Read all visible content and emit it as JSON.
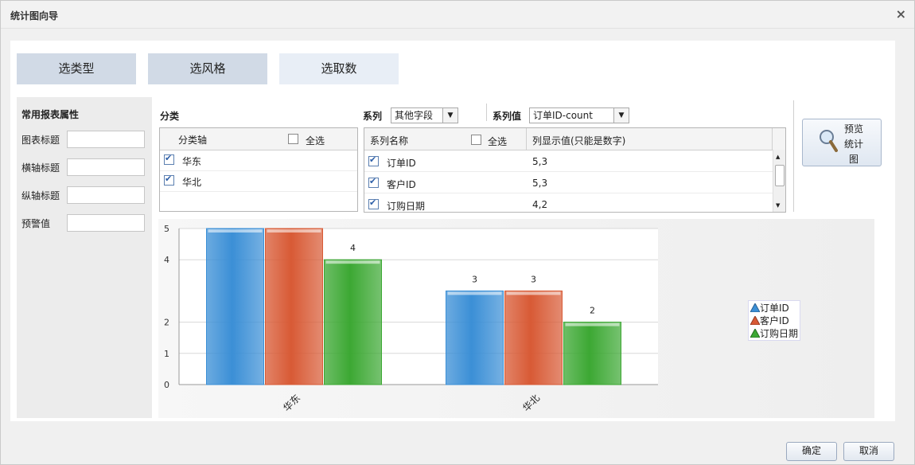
{
  "window": {
    "title": "统计图向导",
    "close_icon": "×"
  },
  "tabs": [
    {
      "label": "选类型",
      "active": false
    },
    {
      "label": "选风格",
      "active": false
    },
    {
      "label": "选取数",
      "active": true
    }
  ],
  "left_panel": {
    "title": "常用报表属性",
    "fields": [
      {
        "label": "图表标题",
        "value": ""
      },
      {
        "label": "横轴标题",
        "value": ""
      },
      {
        "label": "纵轴标题",
        "value": ""
      },
      {
        "label": "预警值",
        "value": ""
      }
    ]
  },
  "category": {
    "label": "分类",
    "header": "分类轴",
    "select_all": "全选",
    "items": [
      {
        "label": "华东",
        "checked": true
      },
      {
        "label": "华北",
        "checked": true
      }
    ]
  },
  "series": {
    "label": "系列",
    "select_value": "其他字段",
    "value_label": "系列值",
    "value_select": "订单ID-count",
    "col_name": "系列名称",
    "select_all": "全选",
    "col_display": "列显示值(只能是数字)",
    "rows": [
      {
        "name": "订单ID",
        "display": "5,3",
        "checked": true
      },
      {
        "name": "客户ID",
        "display": "5,3",
        "checked": true
      },
      {
        "name": "订购日期",
        "display": "4,2",
        "checked": true
      }
    ]
  },
  "preview_button": {
    "line1": "预览",
    "line2": "统计",
    "line3": "图",
    "icon": "magnifier-icon"
  },
  "footer": {
    "ok": "确定",
    "cancel": "取消"
  },
  "colors": {
    "tab": "#d1dae6",
    "tab_active": "#e8eef6",
    "accent": "#2d5fa8"
  },
  "chart_data": {
    "type": "bar",
    "categories": [
      "华东",
      "华北"
    ],
    "series": [
      {
        "name": "订单ID",
        "values": [
          5,
          3
        ],
        "color": "#3b8fd6"
      },
      {
        "name": "客户ID",
        "values": [
          5,
          3
        ],
        "color": "#d85a35"
      },
      {
        "name": "订购日期",
        "values": [
          4,
          2
        ],
        "color": "#3ca833"
      }
    ],
    "data_labels": [
      [
        "",
        "",
        "4"
      ],
      [
        "3",
        "3",
        "2"
      ]
    ],
    "y_ticks": [
      0,
      1,
      2,
      4,
      5
    ],
    "ylim": [
      0,
      5
    ],
    "grid": true,
    "legend": "right"
  }
}
